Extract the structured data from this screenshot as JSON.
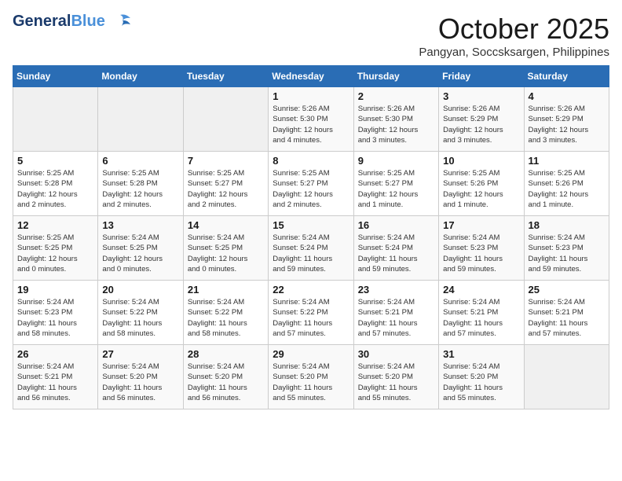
{
  "logo": {
    "name_part1": "General",
    "name_part2": "Blue"
  },
  "title": "October 2025",
  "subtitle": "Pangyan, Soccsksargen, Philippines",
  "days_of_week": [
    "Sunday",
    "Monday",
    "Tuesday",
    "Wednesday",
    "Thursday",
    "Friday",
    "Saturday"
  ],
  "weeks": [
    [
      {
        "day": "",
        "info": ""
      },
      {
        "day": "",
        "info": ""
      },
      {
        "day": "",
        "info": ""
      },
      {
        "day": "1",
        "info": "Sunrise: 5:26 AM\nSunset: 5:30 PM\nDaylight: 12 hours\nand 4 minutes."
      },
      {
        "day": "2",
        "info": "Sunrise: 5:26 AM\nSunset: 5:30 PM\nDaylight: 12 hours\nand 3 minutes."
      },
      {
        "day": "3",
        "info": "Sunrise: 5:26 AM\nSunset: 5:29 PM\nDaylight: 12 hours\nand 3 minutes."
      },
      {
        "day": "4",
        "info": "Sunrise: 5:26 AM\nSunset: 5:29 PM\nDaylight: 12 hours\nand 3 minutes."
      }
    ],
    [
      {
        "day": "5",
        "info": "Sunrise: 5:25 AM\nSunset: 5:28 PM\nDaylight: 12 hours\nand 2 minutes."
      },
      {
        "day": "6",
        "info": "Sunrise: 5:25 AM\nSunset: 5:28 PM\nDaylight: 12 hours\nand 2 minutes."
      },
      {
        "day": "7",
        "info": "Sunrise: 5:25 AM\nSunset: 5:27 PM\nDaylight: 12 hours\nand 2 minutes."
      },
      {
        "day": "8",
        "info": "Sunrise: 5:25 AM\nSunset: 5:27 PM\nDaylight: 12 hours\nand 2 minutes."
      },
      {
        "day": "9",
        "info": "Sunrise: 5:25 AM\nSunset: 5:27 PM\nDaylight: 12 hours\nand 1 minute."
      },
      {
        "day": "10",
        "info": "Sunrise: 5:25 AM\nSunset: 5:26 PM\nDaylight: 12 hours\nand 1 minute."
      },
      {
        "day": "11",
        "info": "Sunrise: 5:25 AM\nSunset: 5:26 PM\nDaylight: 12 hours\nand 1 minute."
      }
    ],
    [
      {
        "day": "12",
        "info": "Sunrise: 5:25 AM\nSunset: 5:25 PM\nDaylight: 12 hours\nand 0 minutes."
      },
      {
        "day": "13",
        "info": "Sunrise: 5:24 AM\nSunset: 5:25 PM\nDaylight: 12 hours\nand 0 minutes."
      },
      {
        "day": "14",
        "info": "Sunrise: 5:24 AM\nSunset: 5:25 PM\nDaylight: 12 hours\nand 0 minutes."
      },
      {
        "day": "15",
        "info": "Sunrise: 5:24 AM\nSunset: 5:24 PM\nDaylight: 11 hours\nand 59 minutes."
      },
      {
        "day": "16",
        "info": "Sunrise: 5:24 AM\nSunset: 5:24 PM\nDaylight: 11 hours\nand 59 minutes."
      },
      {
        "day": "17",
        "info": "Sunrise: 5:24 AM\nSunset: 5:23 PM\nDaylight: 11 hours\nand 59 minutes."
      },
      {
        "day": "18",
        "info": "Sunrise: 5:24 AM\nSunset: 5:23 PM\nDaylight: 11 hours\nand 59 minutes."
      }
    ],
    [
      {
        "day": "19",
        "info": "Sunrise: 5:24 AM\nSunset: 5:23 PM\nDaylight: 11 hours\nand 58 minutes."
      },
      {
        "day": "20",
        "info": "Sunrise: 5:24 AM\nSunset: 5:22 PM\nDaylight: 11 hours\nand 58 minutes."
      },
      {
        "day": "21",
        "info": "Sunrise: 5:24 AM\nSunset: 5:22 PM\nDaylight: 11 hours\nand 58 minutes."
      },
      {
        "day": "22",
        "info": "Sunrise: 5:24 AM\nSunset: 5:22 PM\nDaylight: 11 hours\nand 57 minutes."
      },
      {
        "day": "23",
        "info": "Sunrise: 5:24 AM\nSunset: 5:21 PM\nDaylight: 11 hours\nand 57 minutes."
      },
      {
        "day": "24",
        "info": "Sunrise: 5:24 AM\nSunset: 5:21 PM\nDaylight: 11 hours\nand 57 minutes."
      },
      {
        "day": "25",
        "info": "Sunrise: 5:24 AM\nSunset: 5:21 PM\nDaylight: 11 hours\nand 57 minutes."
      }
    ],
    [
      {
        "day": "26",
        "info": "Sunrise: 5:24 AM\nSunset: 5:21 PM\nDaylight: 11 hours\nand 56 minutes."
      },
      {
        "day": "27",
        "info": "Sunrise: 5:24 AM\nSunset: 5:20 PM\nDaylight: 11 hours\nand 56 minutes."
      },
      {
        "day": "28",
        "info": "Sunrise: 5:24 AM\nSunset: 5:20 PM\nDaylight: 11 hours\nand 56 minutes."
      },
      {
        "day": "29",
        "info": "Sunrise: 5:24 AM\nSunset: 5:20 PM\nDaylight: 11 hours\nand 55 minutes."
      },
      {
        "day": "30",
        "info": "Sunrise: 5:24 AM\nSunset: 5:20 PM\nDaylight: 11 hours\nand 55 minutes."
      },
      {
        "day": "31",
        "info": "Sunrise: 5:24 AM\nSunset: 5:20 PM\nDaylight: 11 hours\nand 55 minutes."
      },
      {
        "day": "",
        "info": ""
      }
    ]
  ]
}
